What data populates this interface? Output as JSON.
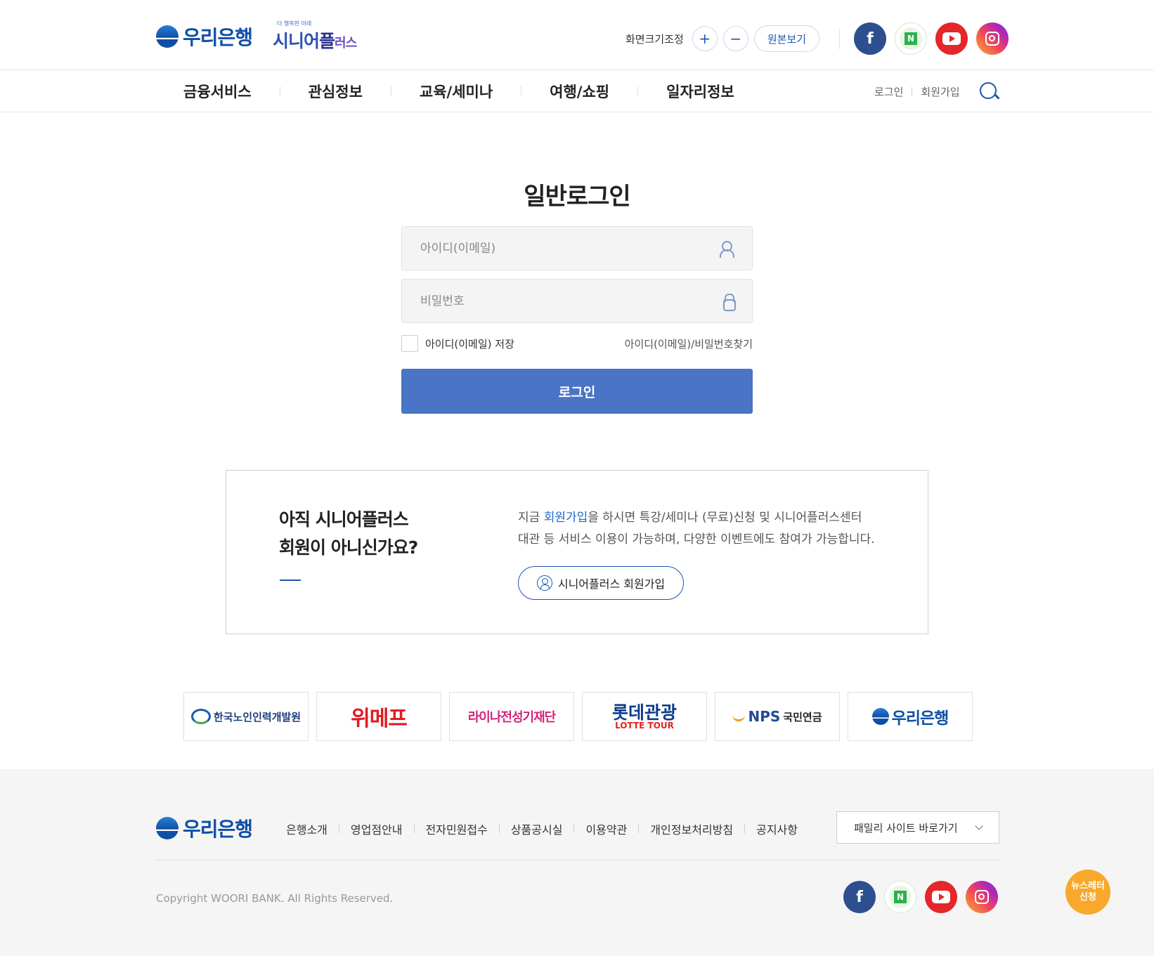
{
  "header": {
    "logo_text": "우리은행",
    "senior_tagline": "더 행복한 미래",
    "senior_name_a": "시니어",
    "senior_name_b": "플",
    "senior_name_c": "러스",
    "font_control_label": "화면크기조정",
    "font_plus": "+",
    "font_minus": "−",
    "original_view": "원본보기",
    "socials": [
      "facebook-icon",
      "naver-blog-icon",
      "youtube-icon",
      "instagram-icon"
    ]
  },
  "nav": {
    "items": [
      "금융서비스",
      "관심정보",
      "교육/세미나",
      "여행/쇼핑",
      "일자리정보"
    ],
    "login": "로그인",
    "signup": "회원가입"
  },
  "login": {
    "title": "일반로그인",
    "id_placeholder": "아이디(이메일)",
    "pw_placeholder": "비밀번호",
    "save_id": "아이디(이메일) 저장",
    "find_link": "아이디(이메일)/비밀번호찾기",
    "button": "로그인"
  },
  "join": {
    "heading_line1": "아직 시니어플러스",
    "heading_line2": "회원이 아니신가요?",
    "desc_prefix": "지금 ",
    "desc_highlight": "회원가입",
    "desc_rest1": "을 하시면 특강/세미나 (무료)신청 및 시니어플러스센터",
    "desc_line2": "대관 등 서비스 이용이 가능하며, 다양한 이벤트에도 참여가 가능합니다.",
    "button": "시니어플러스 회원가입"
  },
  "partners": {
    "p1": "한국노인인력개발원",
    "p2": "위메프",
    "p3": "라이나전성기재단",
    "p4_top": "롯데관광",
    "p4_bottom": "LOTTE TOUR",
    "p5_a": "NPS",
    "p5_b": "국민연금",
    "p6": "우리은행"
  },
  "footer": {
    "logo_text": "우리은행",
    "links": [
      "은행소개",
      "영업점안내",
      "전자민원접수",
      "상품공시실",
      "이용약관",
      "개인정보처리방침",
      "공지사항"
    ],
    "family_site": "패밀리 사이트 바로가기",
    "copyright": "Copyright WOORI BANK. All Rights Reserved.",
    "newsletter_line1": "뉴스레터",
    "newsletter_line2": "신청"
  },
  "colors": {
    "brand_blue": "#0e4fa6",
    "login_button": "#4a74c5",
    "newsletter": "#f8a82a"
  }
}
